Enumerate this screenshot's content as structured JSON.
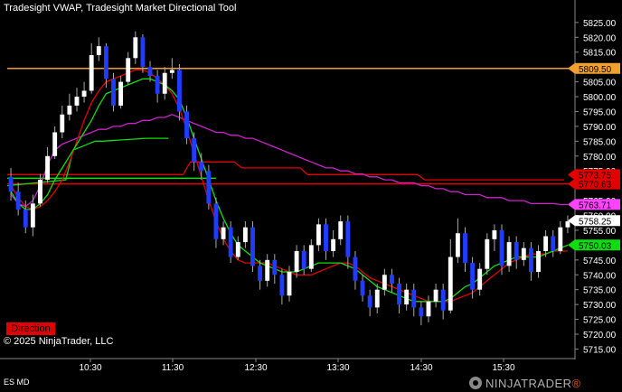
{
  "title": "Tradesight VWAP, Tradesight Market Directional Tool",
  "copyright": "© 2025 NinjaTrader, LLC",
  "direction_label": "Direction",
  "instrument": "ES MD",
  "logo": {
    "text_main": "NINJATRADER",
    "accent_char": "®"
  },
  "colors": {
    "background": "#000000",
    "bull": "#ffffff",
    "bear": "#1f3cff",
    "wick": "#aaaaaa",
    "orange_line": "#f0a030",
    "red_line": "#e00000",
    "green_line": "#10dd10",
    "vwap": "#cc22cc",
    "axis_text": "#ffffff"
  },
  "chart_data": {
    "type": "candlestick",
    "x_ticks": [
      "10:30",
      "11:30",
      "12:30",
      "13:30",
      "14:30",
      "15:30"
    ],
    "y_ticks": [
      5715,
      5720,
      5725,
      5730,
      5735,
      5740,
      5745,
      5750,
      5755,
      5760,
      5765,
      5770,
      5775,
      5780,
      5785,
      5790,
      5795,
      5800,
      5805,
      5810,
      5815,
      5820,
      5825
    ],
    "ylim": [
      5713,
      5828
    ],
    "candles": [
      [
        5773,
        5768,
        5776,
        5765
      ],
      [
        5768,
        5762,
        5771,
        5760
      ],
      [
        5762,
        5756,
        5765,
        5754
      ],
      [
        5756,
        5764,
        5767,
        5753
      ],
      [
        5764,
        5772,
        5774,
        5763
      ],
      [
        5772,
        5780,
        5783,
        5771
      ],
      [
        5780,
        5788,
        5790,
        5779
      ],
      [
        5788,
        5794,
        5797,
        5786
      ],
      [
        5794,
        5797,
        5801,
        5792
      ],
      [
        5797,
        5800,
        5803,
        5795
      ],
      [
        5800,
        5802,
        5805,
        5798
      ],
      [
        5802,
        5814,
        5818,
        5801
      ],
      [
        5814,
        5817,
        5820,
        5812
      ],
      [
        5817,
        5806,
        5818,
        5803
      ],
      [
        5806,
        5797,
        5808,
        5795
      ],
      [
        5797,
        5805,
        5807,
        5796
      ],
      [
        5805,
        5813,
        5815,
        5804
      ],
      [
        5813,
        5820,
        5822,
        5811
      ],
      [
        5820,
        5810,
        5821,
        5808
      ],
      [
        5810,
        5807,
        5812,
        5805
      ],
      [
        5807,
        5801,
        5809,
        5798
      ],
      [
        5801,
        5808,
        5810,
        5799
      ],
      [
        5808,
        5809,
        5813,
        5806
      ],
      [
        5809,
        5795,
        5811,
        5792
      ],
      [
        5795,
        5786,
        5797,
        5784
      ],
      [
        5786,
        5778,
        5788,
        5775
      ],
      [
        5778,
        5775,
        5781,
        5772
      ],
      [
        5775,
        5764,
        5777,
        5762
      ],
      [
        5764,
        5752,
        5766,
        5749
      ],
      [
        5752,
        5756,
        5758,
        5750
      ],
      [
        5756,
        5746,
        5758,
        5744
      ],
      [
        5746,
        5751,
        5753,
        5745
      ],
      [
        5751,
        5756,
        5758,
        5749
      ],
      [
        5756,
        5743,
        5758,
        5741
      ],
      [
        5743,
        5738,
        5745,
        5735
      ],
      [
        5738,
        5745,
        5747,
        5736
      ],
      [
        5745,
        5740,
        5747,
        5737
      ],
      [
        5740,
        5733,
        5742,
        5730
      ],
      [
        5733,
        5741,
        5743,
        5731
      ],
      [
        5741,
        5748,
        5750,
        5739
      ],
      [
        5748,
        5742,
        5750,
        5740
      ],
      [
        5742,
        5750,
        5752,
        5741
      ],
      [
        5750,
        5757,
        5759,
        5748
      ],
      [
        5757,
        5748,
        5759,
        5745
      ],
      [
        5748,
        5752,
        5755,
        5746
      ],
      [
        5752,
        5758,
        5760,
        5750
      ],
      [
        5758,
        5746,
        5760,
        5742
      ],
      [
        5746,
        5738,
        5748,
        5735
      ],
      [
        5738,
        5733,
        5740,
        5731
      ],
      [
        5733,
        5729,
        5735,
        5726
      ],
      [
        5729,
        5735,
        5737,
        5727
      ],
      [
        5735,
        5740,
        5742,
        5733
      ],
      [
        5740,
        5737,
        5742,
        5734
      ],
      [
        5737,
        5730,
        5739,
        5727
      ],
      [
        5730,
        5735,
        5737,
        5728
      ],
      [
        5735,
        5729,
        5737,
        5726
      ],
      [
        5729,
        5726,
        5731,
        5723
      ],
      [
        5726,
        5731,
        5733,
        5724
      ],
      [
        5731,
        5735,
        5737,
        5729
      ],
      [
        5735,
        5728,
        5737,
        5725
      ],
      [
        5728,
        5746,
        5752,
        5727
      ],
      [
        5746,
        5754,
        5759,
        5744
      ],
      [
        5754,
        5744,
        5756,
        5741
      ],
      [
        5744,
        5735,
        5746,
        5732
      ],
      [
        5735,
        5742,
        5744,
        5733
      ],
      [
        5742,
        5752,
        5754,
        5740
      ],
      [
        5752,
        5755,
        5757,
        5748
      ],
      [
        5755,
        5743,
        5757,
        5740
      ],
      [
        5743,
        5751,
        5753,
        5741
      ],
      [
        5751,
        5745,
        5753,
        5742
      ],
      [
        5745,
        5749,
        5751,
        5743
      ],
      [
        5749,
        5741,
        5751,
        5738
      ],
      [
        5741,
        5748,
        5750,
        5739
      ],
      [
        5748,
        5753,
        5755,
        5746
      ],
      [
        5753,
        5748,
        5755,
        5746
      ],
      [
        5748,
        5756,
        5758,
        5747
      ],
      [
        5756,
        5758,
        5760,
        5754
      ]
    ],
    "levels": [
      {
        "name": "orange",
        "value": 5809.5,
        "label": "5809.50",
        "color": "#f0a030",
        "text_color": "#000000"
      },
      {
        "name": "red-upper",
        "value": 5773.75,
        "label": "5773.75",
        "color": "#e00000",
        "text_color": "#000000"
      },
      {
        "name": "red-lower",
        "value": 5770.63,
        "label": "5770.63",
        "color": "#e00000",
        "text_color": "#000000"
      },
      {
        "name": "vwap",
        "value": 5763.71,
        "label": "5763.71",
        "color": "#ff44ff",
        "text_color": "#000000"
      },
      {
        "name": "last",
        "value": 5758.25,
        "label": "5758.25",
        "color": "#ffffff",
        "text_color": "#000000"
      },
      {
        "name": "green",
        "value": 5750.03,
        "label": "5750.03",
        "color": "#10dd10",
        "text_color": "#000000"
      }
    ],
    "horizontal_lines": [
      {
        "value": 5809.5,
        "color": "#f0a030"
      },
      {
        "value": 5770.63,
        "color": "#e00000"
      },
      {
        "value": 5772.5,
        "color": "#10dd10",
        "x_end_fraction": 0.37
      }
    ],
    "vwap_line": [
      5767,
      5764,
      5763,
      5765,
      5770,
      5777,
      5782,
      5784,
      5785,
      5786,
      5787,
      5788,
      5789,
      5789,
      5790,
      5790,
      5791,
      5791,
      5792,
      5792,
      5793,
      5793,
      5794,
      5793,
      5792,
      5791,
      5790,
      5789,
      5788,
      5788,
      5787,
      5787,
      5786,
      5786,
      5785,
      5784,
      5783,
      5782,
      5781,
      5780,
      5779,
      5778,
      5777,
      5776,
      5776,
      5775,
      5775,
      5774,
      5774,
      5773,
      5773,
      5772,
      5772,
      5771,
      5771,
      5771,
      5770,
      5770,
      5769,
      5769,
      5768,
      5768,
      5767,
      5767,
      5767,
      5766,
      5766,
      5766,
      5765,
      5765,
      5765,
      5764,
      5764,
      5764,
      5764,
      5763.7,
      5763.7
    ],
    "red_line": [
      5770,
      5766,
      5763,
      5762,
      5763,
      5765,
      5768,
      5772,
      5778,
      5785,
      5792,
      5798,
      5802,
      5805,
      5806,
      5807,
      5808,
      5809,
      5809,
      5808,
      5806,
      5804,
      5801,
      5796,
      5789,
      5781,
      5773,
      5765,
      5758,
      5752,
      5748,
      5745,
      5744,
      5744,
      5744,
      5744,
      5743,
      5742,
      5741,
      5740,
      5740,
      5740,
      5741,
      5742,
      5743,
      5744,
      5744,
      5743,
      5741,
      5739,
      5738,
      5737,
      5736,
      5735,
      5734,
      5733,
      5732,
      5731,
      5731,
      5731,
      5731,
      5732,
      5733,
      5734,
      5736,
      5738,
      5740,
      5742,
      5744,
      5745,
      5746,
      5747,
      5747,
      5747,
      5748,
      5748,
      5748
    ],
    "green_line": [
      5768,
      5764,
      5762,
      5762,
      5764,
      5767,
      5772,
      5776,
      5780,
      5784,
      5788,
      5792,
      5797,
      5801,
      5802,
      5803,
      5804,
      5805,
      5806,
      5806,
      5805,
      5804,
      5802,
      5799,
      5793,
      5786,
      5779,
      5772,
      5765,
      5759,
      5754,
      5750,
      5748,
      5746,
      5744,
      5743,
      5742,
      5741,
      5741,
      5741,
      5742,
      5743,
      5744,
      5744,
      5744,
      5744,
      5743,
      5742,
      5740,
      5738,
      5736,
      5735,
      5734,
      5733,
      5732,
      5731,
      5731,
      5731,
      5731,
      5731,
      5732,
      5734,
      5736,
      5737,
      5739,
      5741,
      5743,
      5744,
      5745,
      5746,
      5746,
      5746,
      5746,
      5747,
      5748,
      5749,
      5750
    ],
    "red_step": [
      [
        0,
        5773.75
      ],
      [
        24,
        5773.75
      ],
      [
        25,
        5778
      ],
      [
        31,
        5778
      ],
      [
        32,
        5776
      ],
      [
        40,
        5776
      ],
      [
        41,
        5773.75
      ],
      [
        56,
        5773.75
      ],
      [
        57,
        5772
      ],
      [
        76,
        5772
      ]
    ],
    "green_step": [
      [
        0,
        5770
      ],
      [
        8,
        5772
      ],
      [
        9,
        5782
      ],
      [
        12,
        5785
      ],
      [
        13,
        5785
      ],
      [
        19,
        5786
      ],
      [
        20,
        5786
      ],
      [
        22,
        5786
      ]
    ]
  }
}
